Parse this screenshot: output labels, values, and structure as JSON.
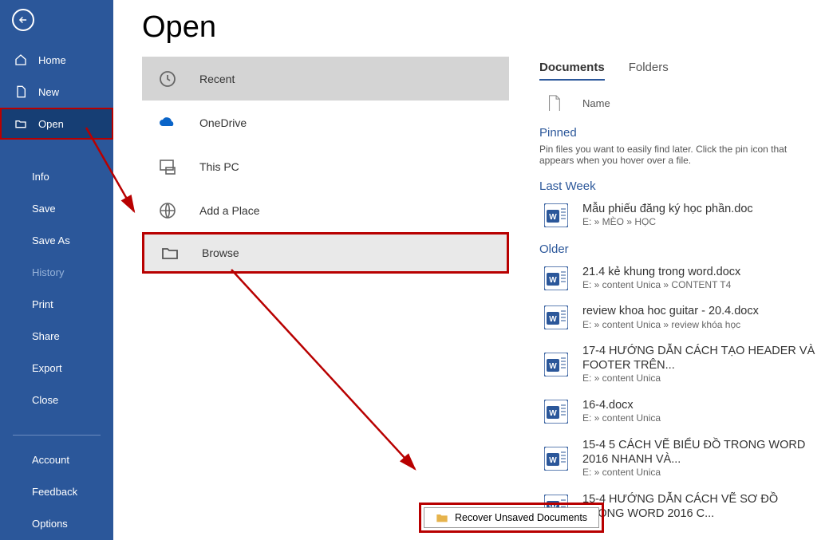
{
  "title": "Open",
  "nav": {
    "home": "Home",
    "new": "New",
    "open": "Open",
    "info": "Info",
    "save": "Save",
    "saveAs": "Save As",
    "history": "History",
    "print": "Print",
    "share": "Share",
    "export": "Export",
    "close": "Close",
    "account": "Account",
    "feedback": "Feedback",
    "options": "Options"
  },
  "locations": {
    "recent": "Recent",
    "onedrive": "OneDrive",
    "thispc": "This PC",
    "addplace": "Add a Place",
    "browse": "Browse"
  },
  "tabs": {
    "documents": "Documents",
    "folders": "Folders"
  },
  "colName": "Name",
  "pinned": {
    "title": "Pinned",
    "hint": "Pin files you want to easily find later. Click the pin icon that appears when you hover over a file."
  },
  "lastWeek": {
    "title": "Last Week"
  },
  "older": {
    "title": "Older"
  },
  "files": {
    "f1": {
      "name": "Mẫu phiếu đăng ký học phần.doc",
      "path": "E: » MÈO » HỌC"
    },
    "f2": {
      "name": "21.4 kẻ khung trong word.docx",
      "path": "E: » content Unica » CONTENT T4"
    },
    "f3": {
      "name": "review khoa hoc guitar - 20.4.docx",
      "path": "E: » content Unica » review khóa học"
    },
    "f4": {
      "name": "17-4 HƯỚNG DẪN CÁCH TẠO HEADER VÀ FOOTER TRÊN...",
      "path": "E: » content Unica"
    },
    "f5": {
      "name": "16-4.docx",
      "path": "E: » content Unica"
    },
    "f6": {
      "name": "15-4 5 CÁCH VẼ BIỂU ĐỒ TRONG WORD 2016 NHANH VÀ...",
      "path": "E: » content Unica"
    },
    "f7": {
      "name": "15-4 HƯỚNG DẪN CÁCH VẼ SƠ ĐỒ TRONG WORD 2016 C...",
      "path": ""
    }
  },
  "recover": "Recover Unsaved Documents"
}
